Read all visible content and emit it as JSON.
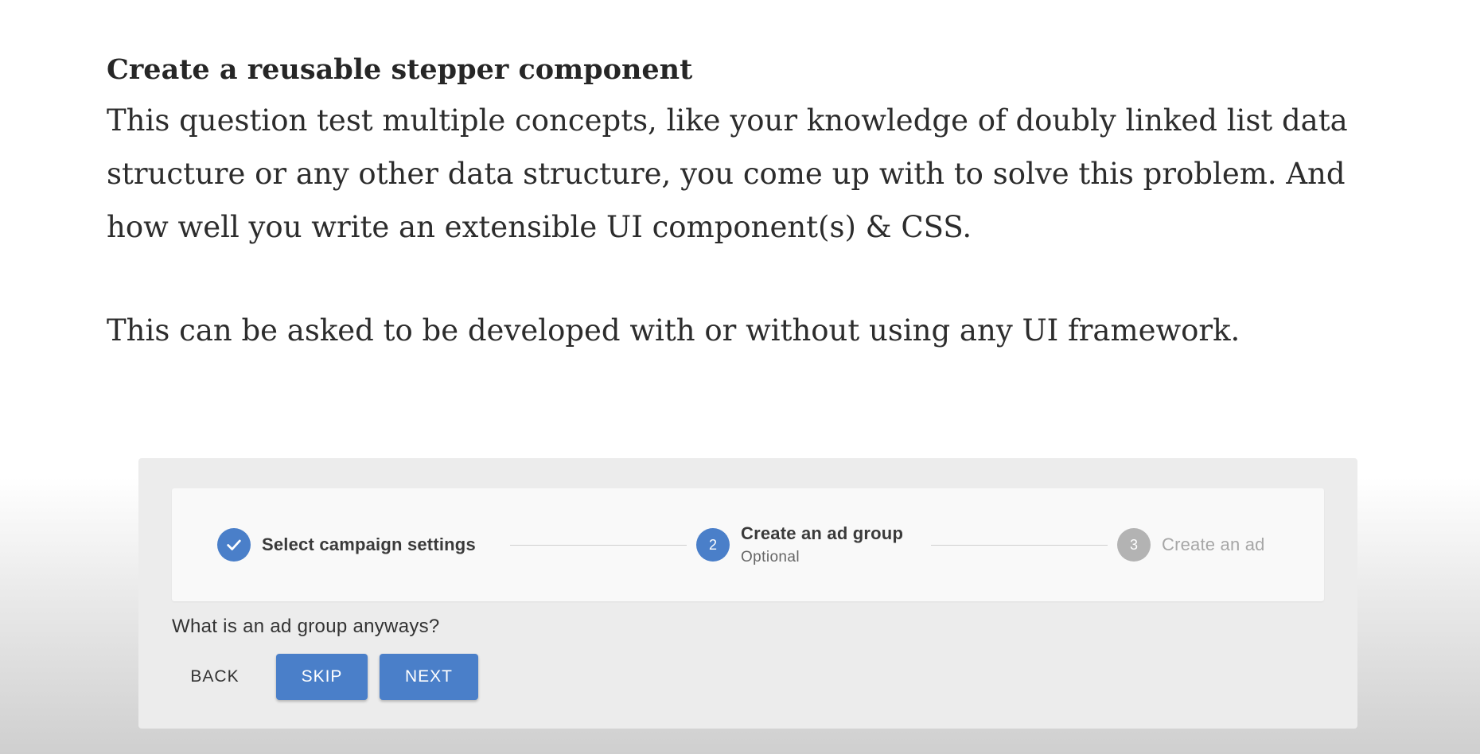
{
  "article": {
    "heading": "Create a reusable stepper component",
    "paragraph1": "This question test multiple concepts, like your knowledge of doubly linked list data structure or any other data structure, you come up with to solve this problem. And how well you write an extensible UI component(s) & CSS.",
    "paragraph2": "This can be asked to be developed with or without using any UI framework."
  },
  "stepper": {
    "steps": [
      {
        "state": "completed",
        "icon": "check-icon",
        "label": "Select campaign settings"
      },
      {
        "state": "active",
        "number": "2",
        "label": "Create an ad group",
        "sublabel": "Optional"
      },
      {
        "state": "pending",
        "number": "3",
        "label": "Create an ad"
      }
    ],
    "colors": {
      "accent": "#4a7fc9",
      "pending": "#b3b3b3"
    }
  },
  "content": {
    "question": "What is an ad group anyways?"
  },
  "actions": {
    "back_label": "BACK",
    "skip_label": "SKIP",
    "next_label": "NEXT"
  }
}
